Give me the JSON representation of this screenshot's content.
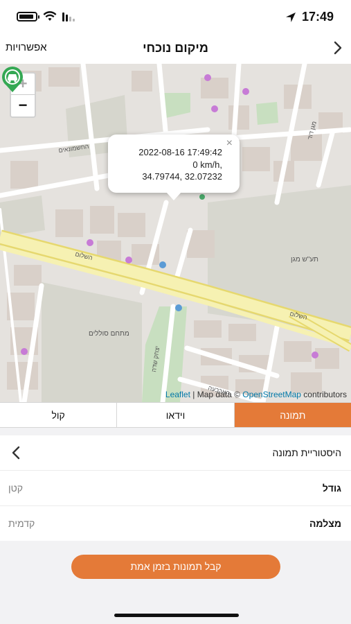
{
  "status_bar": {
    "time": "17:49",
    "icons": [
      "battery-icon",
      "wifi-icon",
      "signal-icon",
      "location-arrow-icon"
    ]
  },
  "nav": {
    "left_label": "אפשרויות",
    "title": "מיקום נוכחי",
    "back_icon": "chevron-right-icon"
  },
  "map": {
    "zoom_in": "+",
    "zoom_out": "−",
    "popup": {
      "close": "×",
      "timestamp": "2022-08-16 17:49:42",
      "speed": "0 km/h,",
      "coordinates": "34.79744, 32.07232"
    },
    "attribution": {
      "leaflet": "Leaflet",
      "separator": " | Map data © ",
      "osm": "OpenStreetMap",
      "contributors": " contributors"
    },
    "labels": {
      "ramp": "השלום",
      "ramp2": "השלום",
      "tower": "תע\"ש מגן",
      "street": "מתחם סוללים",
      "street2": "יצחק שדה",
      "street3": "מגן דוד",
      "street4": "החשמונאים",
      "street5": "הארבעה"
    },
    "colors": {
      "marker": "#34a853",
      "park": "#c8dfc0",
      "road_major": "#f6f1b2",
      "road_border": "#e6d86e"
    }
  },
  "tabs": [
    {
      "label": "תמונה",
      "active": true
    },
    {
      "label": "וידאו",
      "active": false
    },
    {
      "label": "קול",
      "active": false
    }
  ],
  "list": {
    "history": {
      "label": "היסטוריית תמונה",
      "icon": "chevron-left-icon"
    },
    "size": {
      "label": "גודל",
      "value": "קטן"
    },
    "camera": {
      "label": "מצלמה",
      "value": "קדמית"
    }
  },
  "cta_label": "קבל תמונות בזמן אמת",
  "accent_color": "#e47a38"
}
